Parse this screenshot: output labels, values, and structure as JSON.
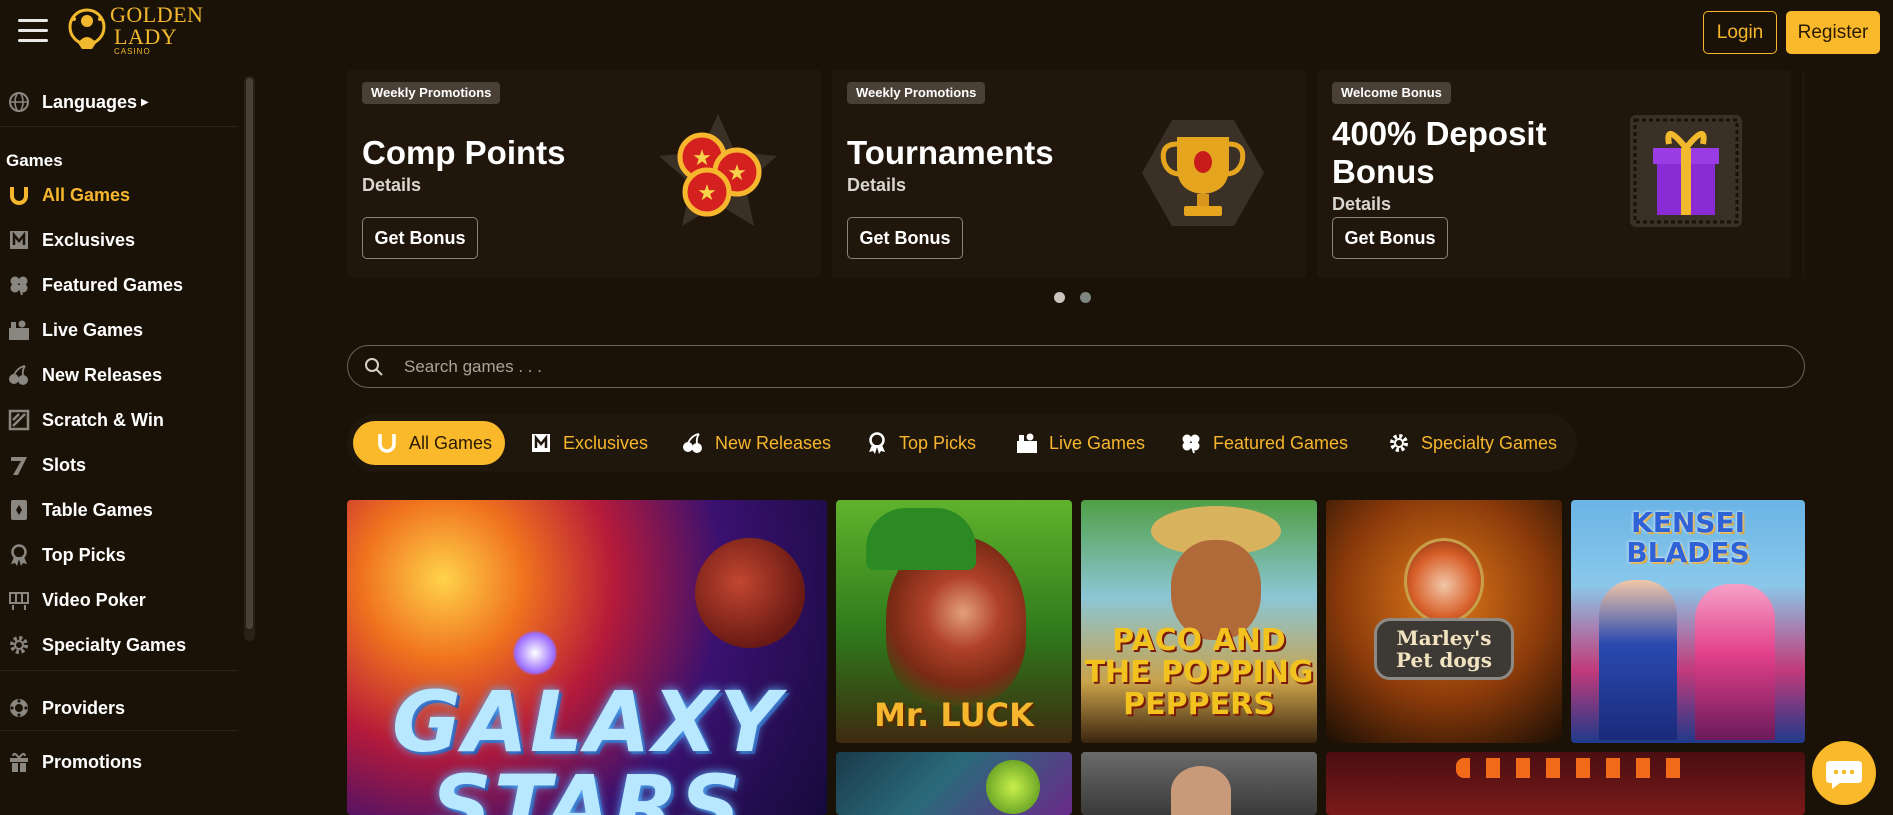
{
  "header": {
    "logo_line1": "GOLDEN",
    "logo_line2": "LADY",
    "logo_sub": "CASINO",
    "login_label": "Login",
    "register_label": "Register"
  },
  "sidebar": {
    "languages_label": "Languages",
    "games_heading": "Games",
    "items": [
      {
        "label": "All Games",
        "icon": "horseshoe-icon"
      },
      {
        "label": "Exclusives",
        "icon": "exclusive-icon"
      },
      {
        "label": "Featured Games",
        "icon": "clover-icon"
      },
      {
        "label": "Live Games",
        "icon": "live-dealer-icon"
      },
      {
        "label": "New Releases",
        "icon": "cherries-icon"
      },
      {
        "label": "Scratch & Win",
        "icon": "scratch-card-icon"
      },
      {
        "label": "Slots",
        "icon": "seven-icon"
      },
      {
        "label": "Table Games",
        "icon": "cards-icon"
      },
      {
        "label": "Top Picks",
        "icon": "award-icon"
      },
      {
        "label": "Video Poker",
        "icon": "poker-machine-icon"
      },
      {
        "label": "Specialty Games",
        "icon": "gear-icon"
      }
    ],
    "providers_label": "Providers",
    "promotions_label": "Promotions"
  },
  "promos": [
    {
      "tag": "Weekly Promotions",
      "title": "Comp Points",
      "details": "Details",
      "button": "Get Bonus",
      "icon": "coins-star-icon"
    },
    {
      "tag": "Weekly Promotions",
      "title": "Tournaments",
      "details": "Details",
      "button": "Get Bonus",
      "icon": "trophy-icon"
    },
    {
      "tag": "Welcome Bonus",
      "title_line1": "400% Deposit",
      "title_line2": "Bonus",
      "details": "Details",
      "button": "Get Bonus",
      "icon": "gift-box-icon"
    }
  ],
  "search": {
    "placeholder": "Search games . . ."
  },
  "tabs": [
    {
      "label": "All Games",
      "active": true
    },
    {
      "label": "Exclusives"
    },
    {
      "label": "New Releases"
    },
    {
      "label": "Top Picks"
    },
    {
      "label": "Live Games"
    },
    {
      "label": "Featured Games"
    },
    {
      "label": "Specialty Games"
    }
  ],
  "games": [
    {
      "title": "GALAXY STARS"
    },
    {
      "title": "Mr. LUCK"
    },
    {
      "title": "PACO AND THE POPPING PEPPERS"
    },
    {
      "title": "Marley's Pet dogs"
    },
    {
      "title": "KENSEI BLADES"
    }
  ],
  "colors": {
    "accent": "#f9b92a",
    "background": "#1a1206",
    "card": "#20160b"
  }
}
